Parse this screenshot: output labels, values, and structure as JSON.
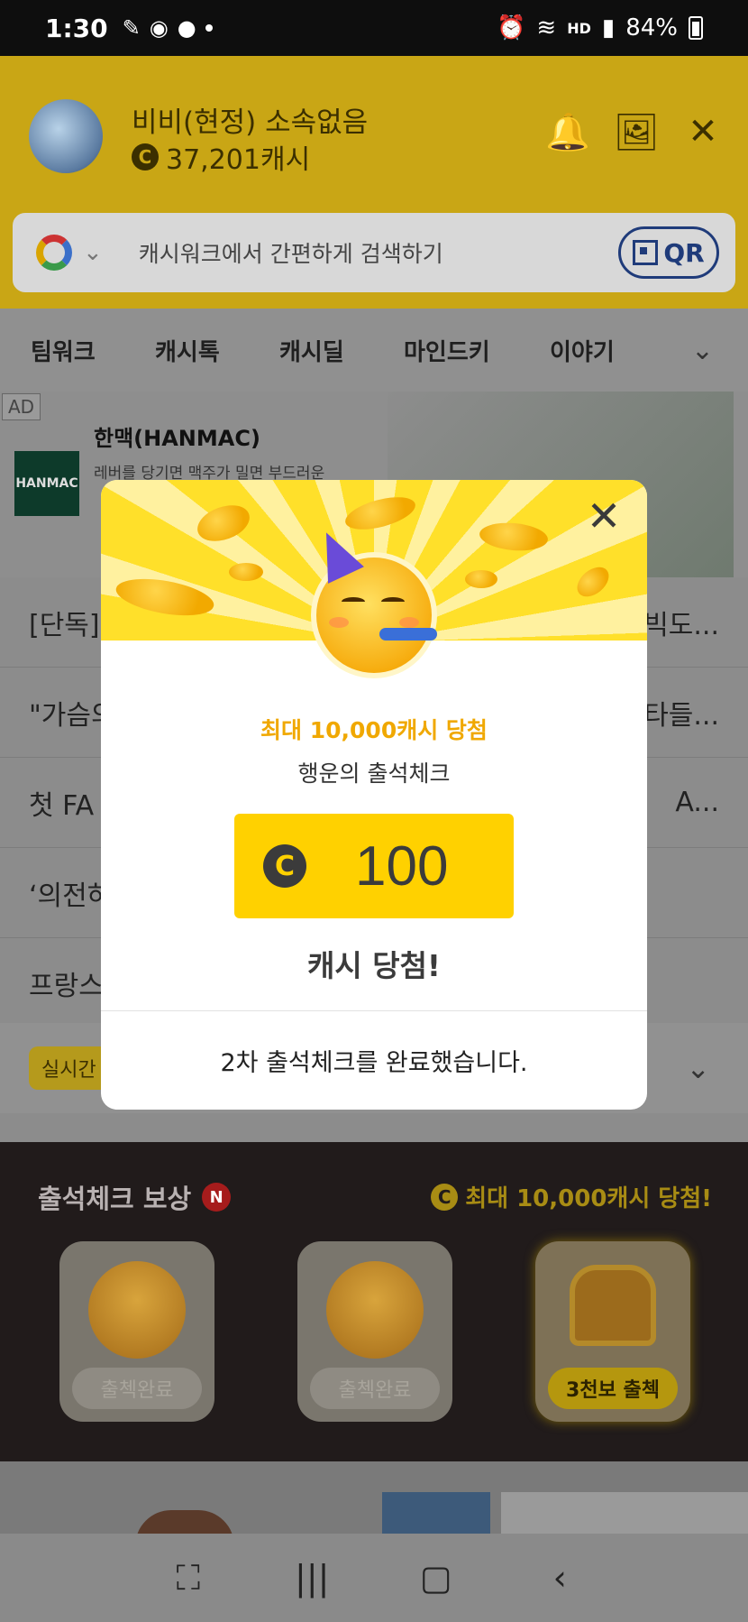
{
  "status_bar": {
    "time": "1:30",
    "battery": "84%",
    "hd_label": "HD"
  },
  "header": {
    "profile_name": "비비(현정) 소속없음",
    "cash_amount": "37,201캐시",
    "search_placeholder": "캐시워크에서 간편하게 검색하기",
    "qr_label": "QR"
  },
  "tabs": [
    "팀워크",
    "캐시톡",
    "캐시딜",
    "마인드키",
    "이야기"
  ],
  "ad": {
    "tag": "AD",
    "brand": "한맥(HANMAC)",
    "logo_text": "HANMAC",
    "description": "레버를 당기면 맥주가 밀면 부드러운"
  },
  "news": [
    {
      "left": "[단독]",
      "right": "빅도..."
    },
    {
      "left": "\"가슴의",
      "right": "타들..."
    },
    {
      "left": "첫 FA",
      "right": "A..."
    },
    {
      "left": "‘의전하",
      "right": ""
    },
    {
      "left": "프랑스",
      "right": ""
    }
  ],
  "realtime_badge": "실시간",
  "attendance": {
    "title": "출석체크 보상",
    "new_badge": "N",
    "max_text": "최대 10,000캐시 당첨!",
    "cards": [
      {
        "label": "출첵완료"
      },
      {
        "label": "출첵완료"
      },
      {
        "label": "3천보 출첵"
      }
    ]
  },
  "modal": {
    "subtitle": "최대 10,000캐시 당첨",
    "event_name": "행운의 출석체크",
    "coin_symbol": "C",
    "amount": "100",
    "win_text": "캐시 당첨!",
    "complete_text": "2차 출석체크를 완료했습니다."
  },
  "colors": {
    "accent_yellow": "#ffd100",
    "modal_top_yellow": "#ffe02a",
    "subtitle_orange": "#f0a800"
  }
}
